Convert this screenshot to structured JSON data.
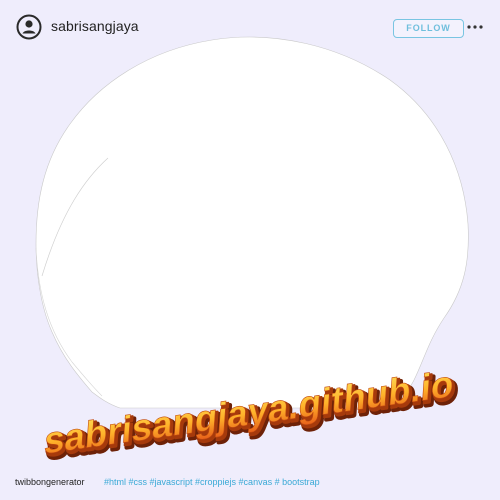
{
  "header": {
    "username": "sabrisangjaya",
    "follow_label": "FOLLOW",
    "avatar_icon": "user-circle-icon",
    "more_icon": "ellipsis-icon"
  },
  "frame": {
    "watermark_text": "sabrisangjaya.github.io"
  },
  "footer": {
    "username": "twibbongenerator",
    "hashtags": "#html #css #javascript #croppiejs #canvas # bootstrap"
  },
  "colors": {
    "background": "#efedfc",
    "follow_accent": "#79c5e2",
    "hashtag": "#39a9d6",
    "watermark_top": "#ffd54a",
    "watermark_bottom": "#e8631a",
    "watermark_shadow": "#8a2a08"
  }
}
